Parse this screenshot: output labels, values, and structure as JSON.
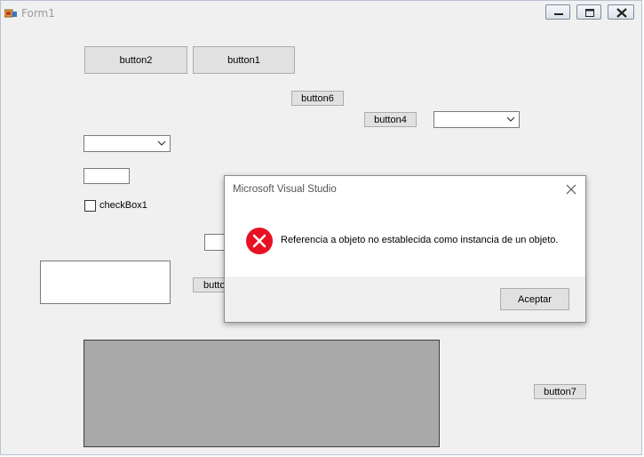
{
  "window": {
    "title": "Form1"
  },
  "buttons": {
    "button2": "button2",
    "button1": "button1",
    "button6": "button6",
    "button4": "button4",
    "button_partial": "buttor",
    "button7": "button7"
  },
  "checkbox": {
    "label": "checkBox1",
    "checked": false
  },
  "dialog": {
    "title": "Microsoft Visual Studio",
    "message": "Referencia a objeto no establecida como instancia de un objeto.",
    "ok_label": "Aceptar",
    "icon": "error-icon"
  },
  "colors": {
    "form_bg": "#f0f0f0",
    "panel_bg": "#a9a9a9",
    "error_red": "#e81123"
  }
}
